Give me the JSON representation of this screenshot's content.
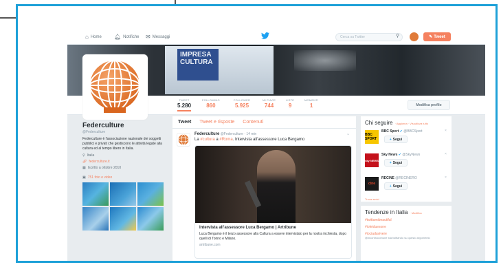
{
  "nav": {
    "home": "Home",
    "notifications": "Notifiche",
    "messages": "Messaggi",
    "search_placeholder": "Cerca su Twitter",
    "tweet_button": "Tweet"
  },
  "banner": {
    "sign_line1": "IMPRESA",
    "sign_line2": "CULTURA"
  },
  "stats": [
    {
      "label": "TWEET",
      "value": "5.280"
    },
    {
      "label": "FOLLOWING",
      "value": "860"
    },
    {
      "label": "FOLLOWER",
      "value": "5.925"
    },
    {
      "label": "MI PIACE",
      "value": "744"
    },
    {
      "label": "LISTE",
      "value": "9"
    },
    {
      "label": "MOMENTI",
      "value": "1"
    }
  ],
  "edit_profile": "Modifica profilo",
  "profile": {
    "name": "Federculture",
    "handle": "@Federculture",
    "bio": "Federculture è l'associazione nazionale dei soggetti pubblici e privati che gestiscono le attività legate alla cultura ed al tempo libero in Italia.",
    "location": "Italia",
    "website": "federculture.it",
    "joined": "Iscritto a ottobre 2010",
    "photos": "751 foto e video"
  },
  "timeline": {
    "tabs": [
      "Tweet",
      "Tweet e risposte",
      "Contenuti"
    ],
    "tweet": {
      "author": "Federculture",
      "handle": "@Federculture",
      "time": "· 14 min",
      "text_pre": "La ",
      "tag1": "#cultura",
      "text_mid": " a ",
      "tag2": "#Roma",
      "text_post": ". Intervista all'assessore Luca Bergamo",
      "card_title": "Intervista all'assessore Luca Bergamo | Artribune",
      "card_desc": "Luca Bergamo è il terzo assessore alla Cultura a essere intervistato per la nostra inchiesta, dopo quelli di Torino e Milano.",
      "card_url": "artribune.com"
    }
  },
  "who_to_follow": {
    "title": "Chi seguire",
    "refresh": "· Aggiorna · Visualizza tutto",
    "follow_label": "Segui",
    "accounts": [
      {
        "name": "BBC Sport",
        "handle": "@BBCSport",
        "logo": "BBC SPORT"
      },
      {
        "name": "Sky News",
        "handle": "@SkyNews",
        "logo": "sky NEWS"
      },
      {
        "name": "RECINE",
        "handle": "@RECINERO",
        "logo": "cine"
      }
    ],
    "find_friends": "Trova amici"
  },
  "trends": {
    "title": "Tendenze in Italia",
    "change": "· Modifica",
    "items": [
      "#twittamibeautiful",
      "#ioleiduesone",
      "#iociadavivere"
    ],
    "sub": "@incontrocomune sta twittando su questo argomento"
  },
  "colors": {
    "accent": "#f5815f",
    "twitter_blue": "#1da1f2",
    "frame": "#1ea1d8"
  }
}
